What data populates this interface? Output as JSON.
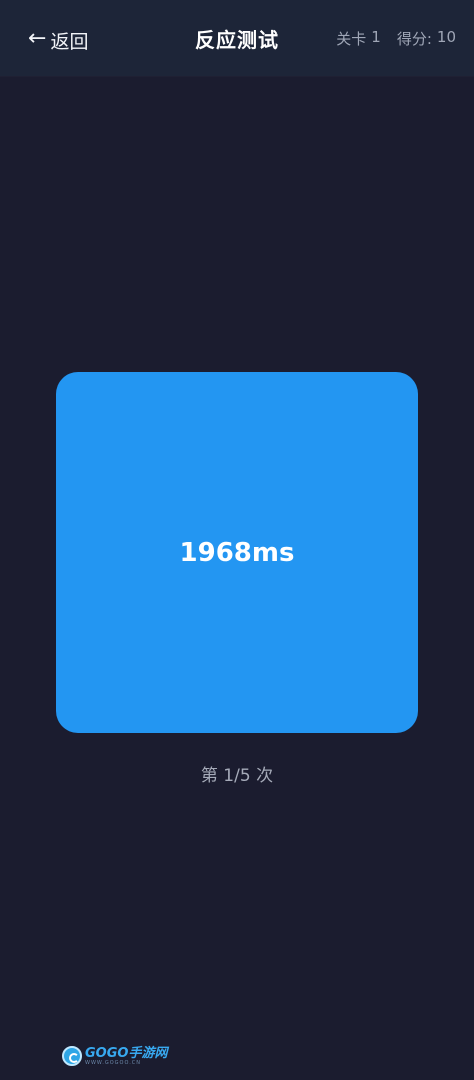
{
  "header": {
    "back_label": "返回",
    "back_arrow": "←",
    "title": "反应测试",
    "level_label": "关卡",
    "level_value": "1",
    "score_label": "得分:",
    "score_value": "10"
  },
  "test": {
    "reaction_time": "1968ms",
    "box_color": "#2396f2"
  },
  "attempt": {
    "text": "第 1/5 次"
  },
  "watermark": {
    "brand": "GOGO手游网",
    "url": "WWW.GOGOO.CN"
  },
  "colors": {
    "background": "#1b1c2f",
    "header": "#1d2538",
    "accent": "#2396f2"
  }
}
